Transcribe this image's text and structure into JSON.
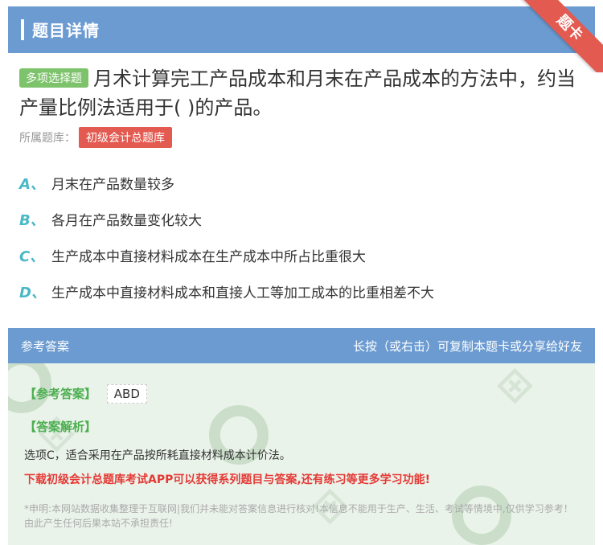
{
  "header": {
    "title": "题目详情"
  },
  "ribbon": {
    "label": "题卡"
  },
  "question": {
    "type_tag": "多项选择题",
    "text": "月术计算完工产品成本和月末在产品成本的方法中，约当产量比例法适用于( )的产品。",
    "bank_label": "所属题库：",
    "bank_name": "初级会计总题库"
  },
  "options": [
    {
      "letter": "A、",
      "text": "月末在产品数量较多"
    },
    {
      "letter": "B、",
      "text": "各月在产品数量变化较大"
    },
    {
      "letter": "C、",
      "text": "生产成本中直接材料成本在生产成本中所占比重很大"
    },
    {
      "letter": "D、",
      "text": "生产成本中直接材料成本和直接人工等加工成本的比重相差不大"
    }
  ],
  "answer_header": {
    "left": "参考答案",
    "right": "长按（或右击）可复制本题卡或分享给好友"
  },
  "answer": {
    "label": "【参考答案】",
    "value": "ABD",
    "explain_label": "【答案解析】",
    "explain_text": "选项C，适合采用在产品按所耗直接材料成本计价法。",
    "promo": "下载初级会计总题库考试APP可以获得系列题目与答案,还有练习等更多学习功能!",
    "disclaimer": "*申明:本网站数据收集整理于互联网|我们并未能对答案信息进行核对!本信息不能用于生产、生活、考试等情境中,仅供学习参考！由此产生任何后果本站不承担责任!"
  },
  "colors": {
    "header_bg": "#6b9bd1",
    "tag_green": "#7dc36b",
    "tag_red": "#e35a50",
    "option_letter": "#4ab8c6",
    "answer_bg": "#eaf3ea"
  }
}
